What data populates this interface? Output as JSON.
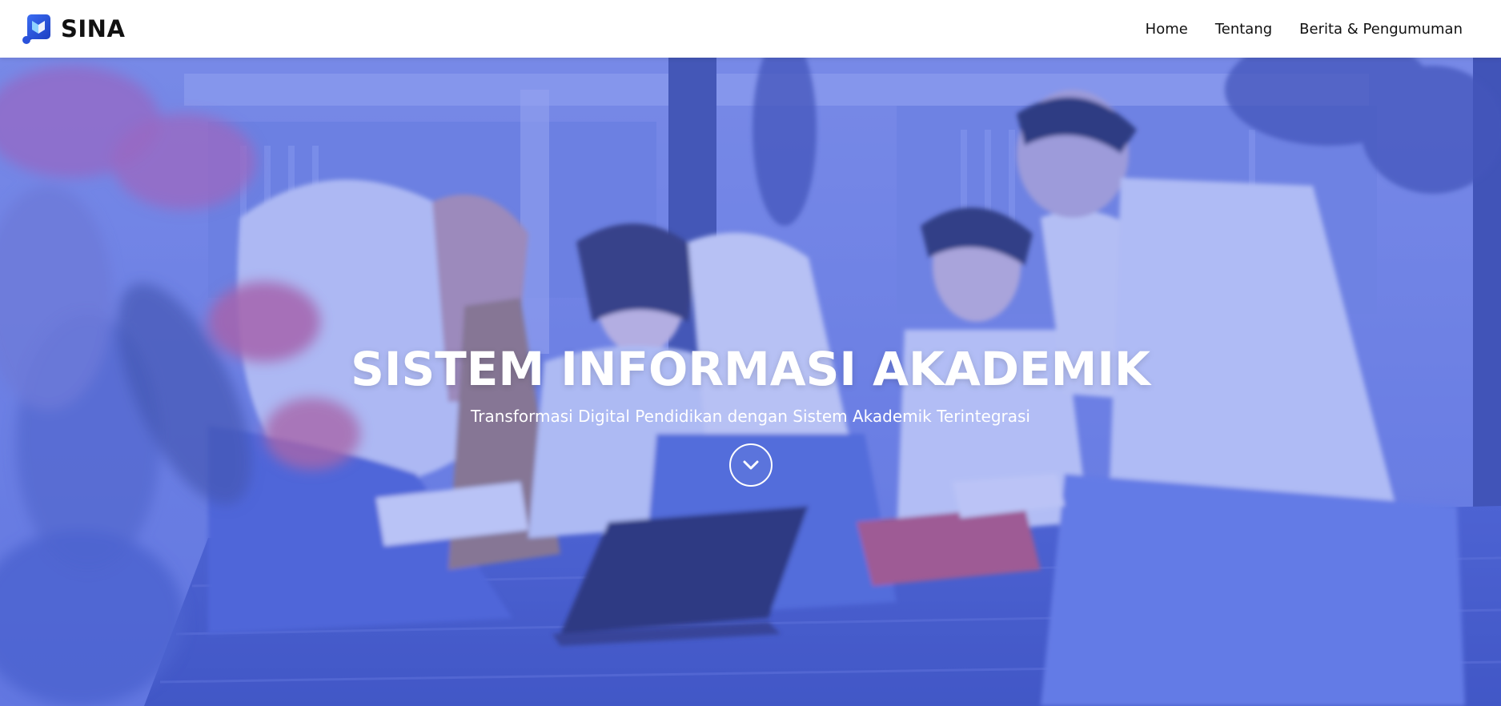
{
  "brand": {
    "name": "SINA",
    "logo_icon": "book-logo-icon",
    "logo_color": "#2f5bea"
  },
  "nav": {
    "items": [
      {
        "label": "Home"
      },
      {
        "label": "Tentang"
      },
      {
        "label": "Berita & Pengumuman"
      }
    ]
  },
  "hero": {
    "title": "SISTEM INFORMASI AKADEMIK",
    "subtitle": "Transformasi Digital Pendidikan dengan Sistem Akademik Terintegrasi",
    "scroll_icon": "chevron-down-icon",
    "overlay_color": "#4f68e4"
  }
}
